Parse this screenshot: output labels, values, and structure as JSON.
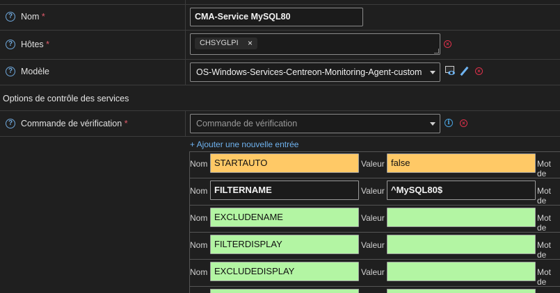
{
  "fields": {
    "nom": {
      "label": "Nom",
      "required": "*",
      "value": "CMA-Service MySQL80"
    },
    "hotes": {
      "label": "Hôtes",
      "required": "*",
      "chips": [
        "CHSYGLPI"
      ],
      "chip_remove": "×"
    },
    "modele": {
      "label": "Modèle",
      "value": "OS-Windows-Services-Centreon-Monitoring-Agent-custom"
    },
    "commande": {
      "label": "Commande de vérification",
      "required": "*",
      "placeholder": "Commande de vérification"
    }
  },
  "help_glyph": "?",
  "section": {
    "title": "Options de contrôle des services"
  },
  "add_entry_link": "+ Ajouter une nouvelle entrée",
  "macro_labels": {
    "nom": "Nom",
    "valeur": "Valeur",
    "mot": "Mot de"
  },
  "macros": [
    {
      "name": "STARTAUTO",
      "value": "false",
      "status": "modified"
    },
    {
      "name": "FILTERNAME",
      "value": "^MySQL80$",
      "status": "normal"
    },
    {
      "name": "EXCLUDENAME",
      "value": "",
      "status": "inherited"
    },
    {
      "name": "FILTERDISPLAY",
      "value": "",
      "status": "inherited"
    },
    {
      "name": "EXCLUDEDISPLAY",
      "value": "",
      "status": "inherited"
    }
  ],
  "colors": {
    "modified": "#ffc966",
    "inherited": "#b3f5a3",
    "normal": "#1b1b1b",
    "accent": "#6fb3f0",
    "danger": "#e0314b"
  },
  "icons": [
    "help-icon",
    "remove-circle-icon",
    "eye-icon",
    "pencil-icon",
    "info-icon",
    "chevron-down-icon"
  ]
}
